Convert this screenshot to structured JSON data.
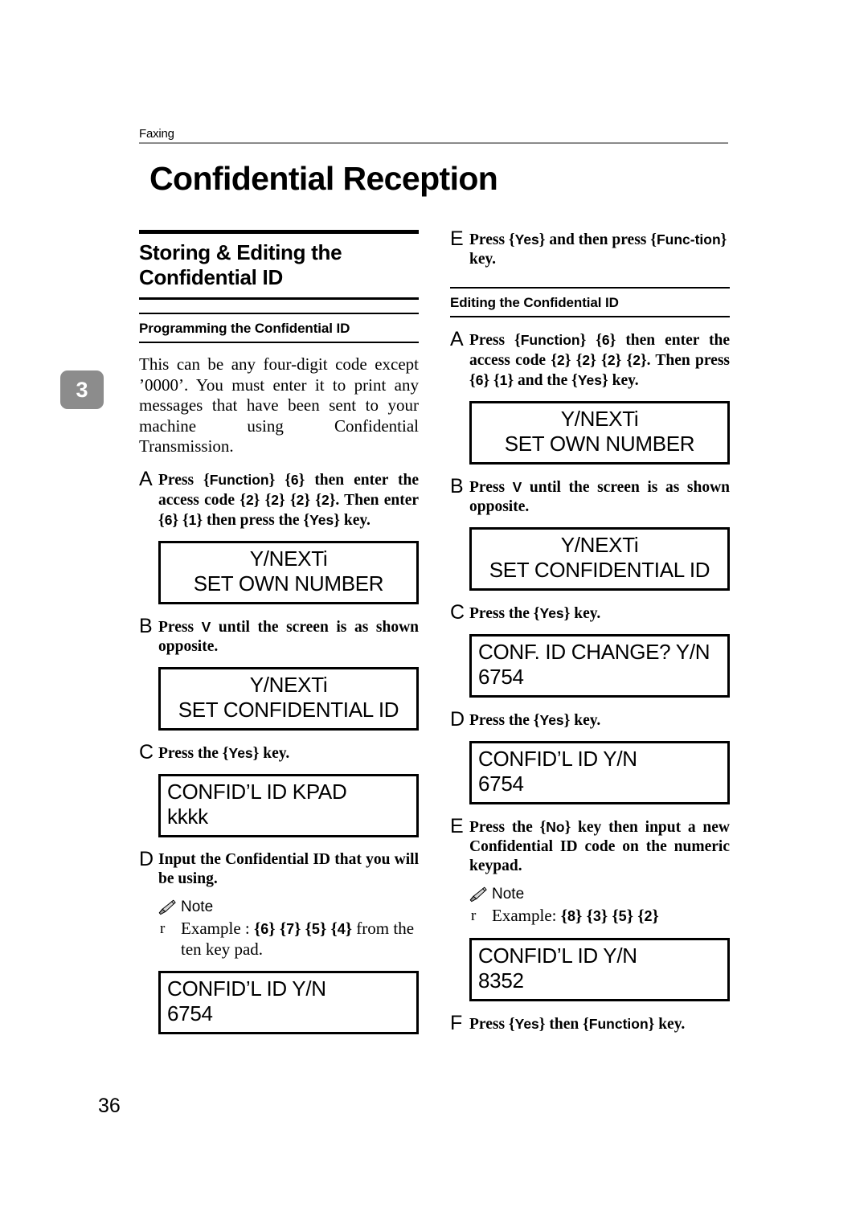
{
  "page": {
    "running_header": "Faxing",
    "title": "Confidential Reception",
    "chapter_tab": "3",
    "page_number": "36"
  },
  "left_column": {
    "section_title": "Storing & Editing the Confidential ID",
    "subsection_title": "Programming the Confidential ID",
    "intro_paragraph": "This can be any four-digit code except ’0000’. You must enter it to print any messages that have been sent to your machine using Confidential Transmission.",
    "steps": [
      {
        "letter": "A",
        "text_parts": [
          {
            "t": "Press ",
            "style": "serif"
          },
          {
            "t": "{",
            "style": "brace"
          },
          {
            "t": "Function",
            "style": "key"
          },
          {
            "t": "} ",
            "style": "brace"
          },
          {
            "t": "{",
            "style": "brace"
          },
          {
            "t": "6",
            "style": "key"
          },
          {
            "t": "} ",
            "style": "brace"
          },
          {
            "t": "then  enter the access code ",
            "style": "serif"
          },
          {
            "t": "{",
            "style": "brace"
          },
          {
            "t": "2",
            "style": "key"
          },
          {
            "t": "} ",
            "style": "brace"
          },
          {
            "t": "{",
            "style": "brace"
          },
          {
            "t": "2",
            "style": "key"
          },
          {
            "t": "} ",
            "style": "brace"
          },
          {
            "t": "{",
            "style": "brace"
          },
          {
            "t": "2",
            "style": "key"
          },
          {
            "t": "} ",
            "style": "brace"
          },
          {
            "t": "{",
            "style": "brace"
          },
          {
            "t": "2",
            "style": "key"
          },
          {
            "t": "}",
            "style": "brace"
          },
          {
            "t": ". Then enter ",
            "style": "serif"
          },
          {
            "t": "{",
            "style": "brace"
          },
          {
            "t": "6",
            "style": "key"
          },
          {
            "t": "} ",
            "style": "brace"
          },
          {
            "t": "{",
            "style": "brace"
          },
          {
            "t": "1",
            "style": "key"
          },
          {
            "t": "} ",
            "style": "brace"
          },
          {
            "t": "then press the ",
            "style": "serif"
          },
          {
            "t": "{",
            "style": "brace"
          },
          {
            "t": "Yes",
            "style": "key"
          },
          {
            "t": "} ",
            "style": "brace"
          },
          {
            "t": "key.",
            "style": "serif"
          }
        ]
      },
      {
        "letter": "B",
        "text_parts": [
          {
            "t": "Press  ",
            "style": "serif"
          },
          {
            "t": "V",
            "style": "key"
          },
          {
            "t": "  until  the  screen  is  as shown opposite.",
            "style": "serif"
          }
        ]
      },
      {
        "letter": "C",
        "text_parts": [
          {
            "t": "Press the ",
            "style": "serif"
          },
          {
            "t": "{",
            "style": "brace"
          },
          {
            "t": "Yes",
            "style": "key"
          },
          {
            "t": "} ",
            "style": "brace"
          },
          {
            "t": "key.",
            "style": "serif"
          }
        ]
      },
      {
        "letter": "D",
        "text_parts": [
          {
            "t": "Input  the  Confidential  ID  that you will be using.",
            "style": "serif"
          }
        ]
      }
    ],
    "lcd_1": {
      "line1": "Y/NEXTi",
      "line2": "SET OWN NUMBER",
      "align": "center"
    },
    "lcd_2": {
      "line1": "Y/NEXTi",
      "line2": "SET CONFIDENTIAL ID",
      "align": "center"
    },
    "lcd_3": {
      "line1": "CONFID’L ID     KPAD",
      "line2": "kkkk",
      "align": "left"
    },
    "lcd_4": {
      "line1": "CONFID’L ID     Y/N",
      "line2": "6754",
      "align": "left"
    },
    "note": {
      "label": "Note",
      "icon": "pencil-icon",
      "bullet": "r",
      "text_parts": [
        {
          "t": "Example : ",
          "style": "serif"
        },
        {
          "t": "{",
          "style": "brace"
        },
        {
          "t": "6",
          "style": "key"
        },
        {
          "t": "} ",
          "style": "brace"
        },
        {
          "t": "{",
          "style": "brace"
        },
        {
          "t": "7",
          "style": "key"
        },
        {
          "t": "} ",
          "style": "brace"
        },
        {
          "t": "{",
          "style": "brace"
        },
        {
          "t": "5",
          "style": "key"
        },
        {
          "t": "} ",
          "style": "brace"
        },
        {
          "t": "{",
          "style": "brace"
        },
        {
          "t": "4",
          "style": "key"
        },
        {
          "t": "} ",
          "style": "brace"
        },
        {
          "t": "from the ten key pad.",
          "style": "serif"
        }
      ]
    }
  },
  "right_column": {
    "subsection_title": "Editing the Confidential ID",
    "step_e_top": {
      "letter": "E",
      "text_parts": [
        {
          "t": "Press ",
          "style": "serif"
        },
        {
          "t": "{",
          "style": "brace"
        },
        {
          "t": "Yes",
          "style": "key"
        },
        {
          "t": "} ",
          "style": "brace"
        },
        {
          "t": "and then press ",
          "style": "serif"
        },
        {
          "t": "{",
          "style": "brace"
        },
        {
          "t": "Func-",
          "style": "key"
        },
        {
          "t": "",
          "style": "serif"
        },
        {
          "t": "tion",
          "style": "key"
        },
        {
          "t": "} ",
          "style": "brace"
        },
        {
          "t": "key.",
          "style": "serif"
        }
      ]
    },
    "steps": [
      {
        "letter": "A",
        "text_parts": [
          {
            "t": "Press ",
            "style": "serif"
          },
          {
            "t": "{",
            "style": "brace"
          },
          {
            "t": "Function",
            "style": "key"
          },
          {
            "t": "} ",
            "style": "brace"
          },
          {
            "t": "{",
            "style": "brace"
          },
          {
            "t": "6",
            "style": "key"
          },
          {
            "t": "} ",
            "style": "brace"
          },
          {
            "t": "then enter the access code ",
            "style": "serif"
          },
          {
            "t": "{",
            "style": "brace"
          },
          {
            "t": "2",
            "style": "key"
          },
          {
            "t": "} ",
            "style": "brace"
          },
          {
            "t": "{",
            "style": "brace"
          },
          {
            "t": "2",
            "style": "key"
          },
          {
            "t": "} ",
            "style": "brace"
          },
          {
            "t": "{",
            "style": "brace"
          },
          {
            "t": "2",
            "style": "key"
          },
          {
            "t": "} ",
            "style": "brace"
          },
          {
            "t": "{",
            "style": "brace"
          },
          {
            "t": "2",
            "style": "key"
          },
          {
            "t": "}",
            "style": "brace"
          },
          {
            "t": ". Then press ",
            "style": "serif"
          },
          {
            "t": "{",
            "style": "brace"
          },
          {
            "t": "6",
            "style": "key"
          },
          {
            "t": "} ",
            "style": "brace"
          },
          {
            "t": "{",
            "style": "brace"
          },
          {
            "t": "1",
            "style": "key"
          },
          {
            "t": "} ",
            "style": "brace"
          },
          {
            "t": "and the ",
            "style": "serif"
          },
          {
            "t": "{",
            "style": "brace"
          },
          {
            "t": "Yes",
            "style": "key"
          },
          {
            "t": "} ",
            "style": "brace"
          },
          {
            "t": "key.",
            "style": "serif"
          }
        ]
      },
      {
        "letter": "B",
        "text_parts": [
          {
            "t": "Press  ",
            "style": "serif"
          },
          {
            "t": "V",
            "style": "key"
          },
          {
            "t": "  until  the  screen  is  as shown opposite.",
            "style": "serif"
          }
        ]
      },
      {
        "letter": "C",
        "text_parts": [
          {
            "t": "Press the ",
            "style": "serif"
          },
          {
            "t": "{",
            "style": "brace"
          },
          {
            "t": "Yes",
            "style": "key"
          },
          {
            "t": "} ",
            "style": "brace"
          },
          {
            "t": "key.",
            "style": "serif"
          }
        ]
      },
      {
        "letter": "D",
        "text_parts": [
          {
            "t": "Press the ",
            "style": "serif"
          },
          {
            "t": "{",
            "style": "brace"
          },
          {
            "t": "Yes",
            "style": "key"
          },
          {
            "t": "} ",
            "style": "brace"
          },
          {
            "t": "key.",
            "style": "serif"
          }
        ]
      },
      {
        "letter": "E",
        "text_parts": [
          {
            "t": "Press  the  ",
            "style": "serif"
          },
          {
            "t": "{",
            "style": "brace"
          },
          {
            "t": "No",
            "style": "key"
          },
          {
            "t": "} ",
            "style": "brace"
          },
          {
            "t": "key  then  input  a new Confidential ID code on the numeric keypad.",
            "style": "serif"
          }
        ]
      },
      {
        "letter": "F",
        "text_parts": [
          {
            "t": "Press ",
            "style": "serif"
          },
          {
            "t": "{",
            "style": "brace"
          },
          {
            "t": "Yes",
            "style": "key"
          },
          {
            "t": "} ",
            "style": "brace"
          },
          {
            "t": "then ",
            "style": "serif"
          },
          {
            "t": "{",
            "style": "brace"
          },
          {
            "t": "Function",
            "style": "key"
          },
          {
            "t": "} ",
            "style": "brace"
          },
          {
            "t": "key.",
            "style": "serif"
          }
        ]
      }
    ],
    "lcd_1": {
      "line1": "Y/NEXTi",
      "line2": "SET OWN NUMBER",
      "align": "center"
    },
    "lcd_2": {
      "line1": "Y/NEXTi",
      "line2": "SET CONFIDENTIAL ID",
      "align": "center"
    },
    "lcd_3": {
      "line1": "CONF. ID CHANGE? Y/N",
      "line2": "6754",
      "align": "left"
    },
    "lcd_4": {
      "line1": "CONFID’L ID     Y/N",
      "line2": "6754",
      "align": "left"
    },
    "lcd_5": {
      "line1": "CONFID’L ID     Y/N",
      "line2": "8352",
      "align": "left"
    },
    "note": {
      "label": "Note",
      "icon": "pencil-icon",
      "bullet": "r",
      "text_parts": [
        {
          "t": "Example: ",
          "style": "serif"
        },
        {
          "t": "{",
          "style": "brace"
        },
        {
          "t": "8",
          "style": "key"
        },
        {
          "t": "} ",
          "style": "brace"
        },
        {
          "t": "{",
          "style": "brace"
        },
        {
          "t": "3",
          "style": "key"
        },
        {
          "t": "} ",
          "style": "brace"
        },
        {
          "t": "{",
          "style": "brace"
        },
        {
          "t": "5",
          "style": "key"
        },
        {
          "t": "} ",
          "style": "brace"
        },
        {
          "t": "{",
          "style": "brace"
        },
        {
          "t": "2",
          "style": "key"
        },
        {
          "t": "}",
          "style": "brace"
        }
      ]
    }
  }
}
